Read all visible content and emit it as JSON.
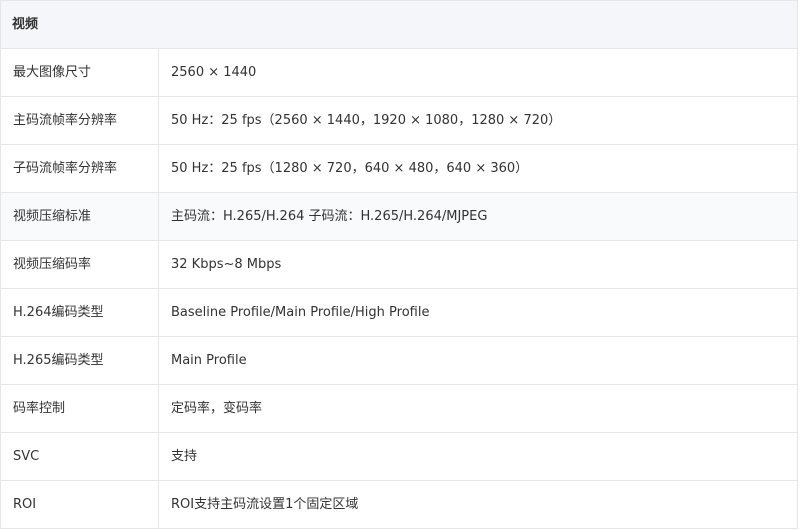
{
  "section": {
    "title": "视频"
  },
  "rows": [
    {
      "label": "最大图像尺寸",
      "value": "2560 × 1440"
    },
    {
      "label": "主码流帧率分辨率",
      "value": "50 Hz：25 fps（2560 × 1440，1920 × 1080，1280 × 720）"
    },
    {
      "label": "子码流帧率分辨率",
      "value": "50 Hz：25 fps（1280 × 720，640 × 480，640 × 360）"
    },
    {
      "label": "视频压缩标准",
      "value": "主码流：H.265/H.264 子码流：H.265/H.264/MJPEG"
    },
    {
      "label": "视频压缩码率",
      "value": "32 Kbps~8 Mbps"
    },
    {
      "label": "H.264编码类型",
      "value": "Baseline Profile/Main Profile/High Profile"
    },
    {
      "label": "H.265编码类型",
      "value": "Main Profile"
    },
    {
      "label": "码率控制",
      "value": "定码率，变码率"
    },
    {
      "label": "SVC",
      "value": "支持"
    },
    {
      "label": "ROI",
      "value": "ROI支持主码流设置1个固定区域"
    }
  ]
}
